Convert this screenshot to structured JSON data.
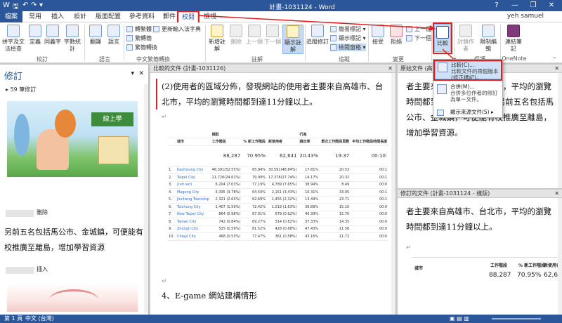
{
  "titlebar": {
    "title": "計畫-1031124 - Word",
    "help": "?",
    "minimize": "—",
    "restore": "❐",
    "close": "✕"
  },
  "tabs": [
    "檔案",
    "常用",
    "插入",
    "設計",
    "版面配置",
    "參考資料",
    "郵件",
    "校閱",
    "檢視"
  ],
  "user": "yeh samuel",
  "ribbon": {
    "proofing": {
      "label": "校訂",
      "spell": "拼字及文法檢查",
      "define": "定義",
      "thesaurus": "同義字",
      "wordcount": "字數統計"
    },
    "language": {
      "label": "語言",
      "translate": "翻譯",
      "lang": "語言"
    },
    "chinese": {
      "label": "中文繁簡轉換",
      "to_trad": "轉繁體",
      "to_simp": "繁轉簡",
      "convert": "繁簡轉換",
      "update": "更新輸入法字典"
    },
    "comments": {
      "label": "註解",
      "new": "新增註解",
      "delete": "刪除",
      "prev": "上一個",
      "next": "下一個",
      "show": "顯示註解"
    },
    "tracking": {
      "label": "追蹤",
      "track": "追蹤修訂",
      "simple": "簡易標記",
      "showmark": "顯示標記",
      "pane": "檢閱窗格"
    },
    "changes": {
      "label": "變更",
      "accept": "接受",
      "reject": "拒絕",
      "prev": "上一個",
      "next": "下一個"
    },
    "compare": {
      "label": "比較",
      "btn": "比較"
    },
    "protect": {
      "label": "保護",
      "block": "封鎖作者",
      "restrict": "限制編輯"
    },
    "onenote": {
      "label": "OneNote",
      "link": "連結筆記"
    }
  },
  "dropdown": {
    "compare": "比較(C)...",
    "compare_desc": "比較文件的兩個版本 (修正標記)。",
    "combine": "合併(M)...",
    "combine_desc": "合併多位作者的修訂為單一文件。",
    "show_source": "顯示來源文件(S)"
  },
  "revision_pane": {
    "title": "修訂",
    "count": "59 筆修訂",
    "author1": "刪除",
    "text": "另前五名包括馬公市、金城鎮，可便能有校推廣至離島，增加學習資源",
    "author2": "插入",
    "image_label": "線上學"
  },
  "compare_pane": {
    "header": "比較的文件 (計畫-1031126)",
    "para1": "(2)使用者的區域分佈，發現網站的使用者主要來自高雄市、台北市，平均的瀏覽時間都到達11分鐘以上。",
    "para2": "4、E-game 網站建構情形",
    "table": {
      "headers": [
        "城市",
        "工作階段",
        "% 新工作階段",
        "新使用者",
        "跳出率",
        "單次工作階段頁數",
        "平均工作階段時間長度"
      ],
      "group1": "擷取",
      "group2": "行為",
      "totals": [
        "88,287",
        "70.95%",
        "62,641",
        "20.43%",
        "19.37",
        "00:10:"
      ],
      "rows": [
        [
          "1.",
          "Kaohsiung City",
          "46,391(52.55%)",
          "65.94%",
          "30,591(48.84%)",
          "17.81%",
          "20.53",
          "00:1"
        ],
        [
          "2.",
          "Taipei City",
          "21,726(24.61%)",
          "79.99%",
          "17,378(27.74%)",
          "14.17%",
          "20.32",
          "00:1"
        ],
        [
          "3.",
          "(not set)",
          "6,204 (7.03%)",
          "77.19%",
          "4,789 (7.65%)",
          "38.94%",
          "8.49",
          "00:0"
        ],
        [
          "4.",
          "Magong City",
          "3,335 (3.78%)",
          "64.50%",
          "2,151 (3.43%)",
          "10.31%",
          "33.05",
          "00:1"
        ],
        [
          "5.",
          "Jincheng Township",
          "2,321 (2.63%)",
          "62.69%",
          "1,455 (2.32%)",
          "13.49%",
          "23.71",
          "00:1"
        ],
        [
          "6.",
          "Taichung City",
          "1,407 (1.59%)",
          "72.42%",
          "1,019 (1.63%)",
          "36.89%",
          "15.10",
          "00:0"
        ],
        [
          "7.",
          "New Taipei City",
          "864 (0.98%)",
          "67.01%",
          "579 (0.92%)",
          "40.39%",
          "15.70",
          "00:0"
        ],
        [
          "8.",
          "Tainan City",
          "742 (0.84%)",
          "69.27%",
          "514 (0.82%)",
          "37.33%",
          "14.35",
          "00:0"
        ],
        [
          "9.",
          "Zhongli City",
          "525 (0.59%)",
          "81.52%",
          "428 (0.68%)",
          "47.43%",
          "11.58",
          "00:0"
        ],
        [
          "10.",
          "Chiayi City",
          "468 (0.53%)",
          "77.47%",
          "361 (0.58%)",
          "43.16%",
          "11.72",
          "00:0"
        ]
      ]
    }
  },
  "orig_pane": {
    "header": "原始文件 (高雄市-夢想的翅膀)",
    "text": "者主要來自高雄市、台北市，平均的瀏覽時間都到達11分鐘以上。另前五名包括馬公市、金城鎮，可便能有校推廣至離島，增加學習資源。"
  },
  "mod_pane": {
    "header": "修訂的文件 (計畫-1031124 - 樣版)",
    "text": "者主要來自高雄市、台北市，平均的瀏覽時間都到達11分鐘以上。",
    "totals": [
      "88,287",
      "70.95%",
      "62,64"
    ]
  },
  "statusbar": {
    "page": "第 1 頁",
    "words": "中文 (台灣)"
  },
  "colors": {
    "accent": "#2b579a",
    "highlight": "#e02020"
  }
}
